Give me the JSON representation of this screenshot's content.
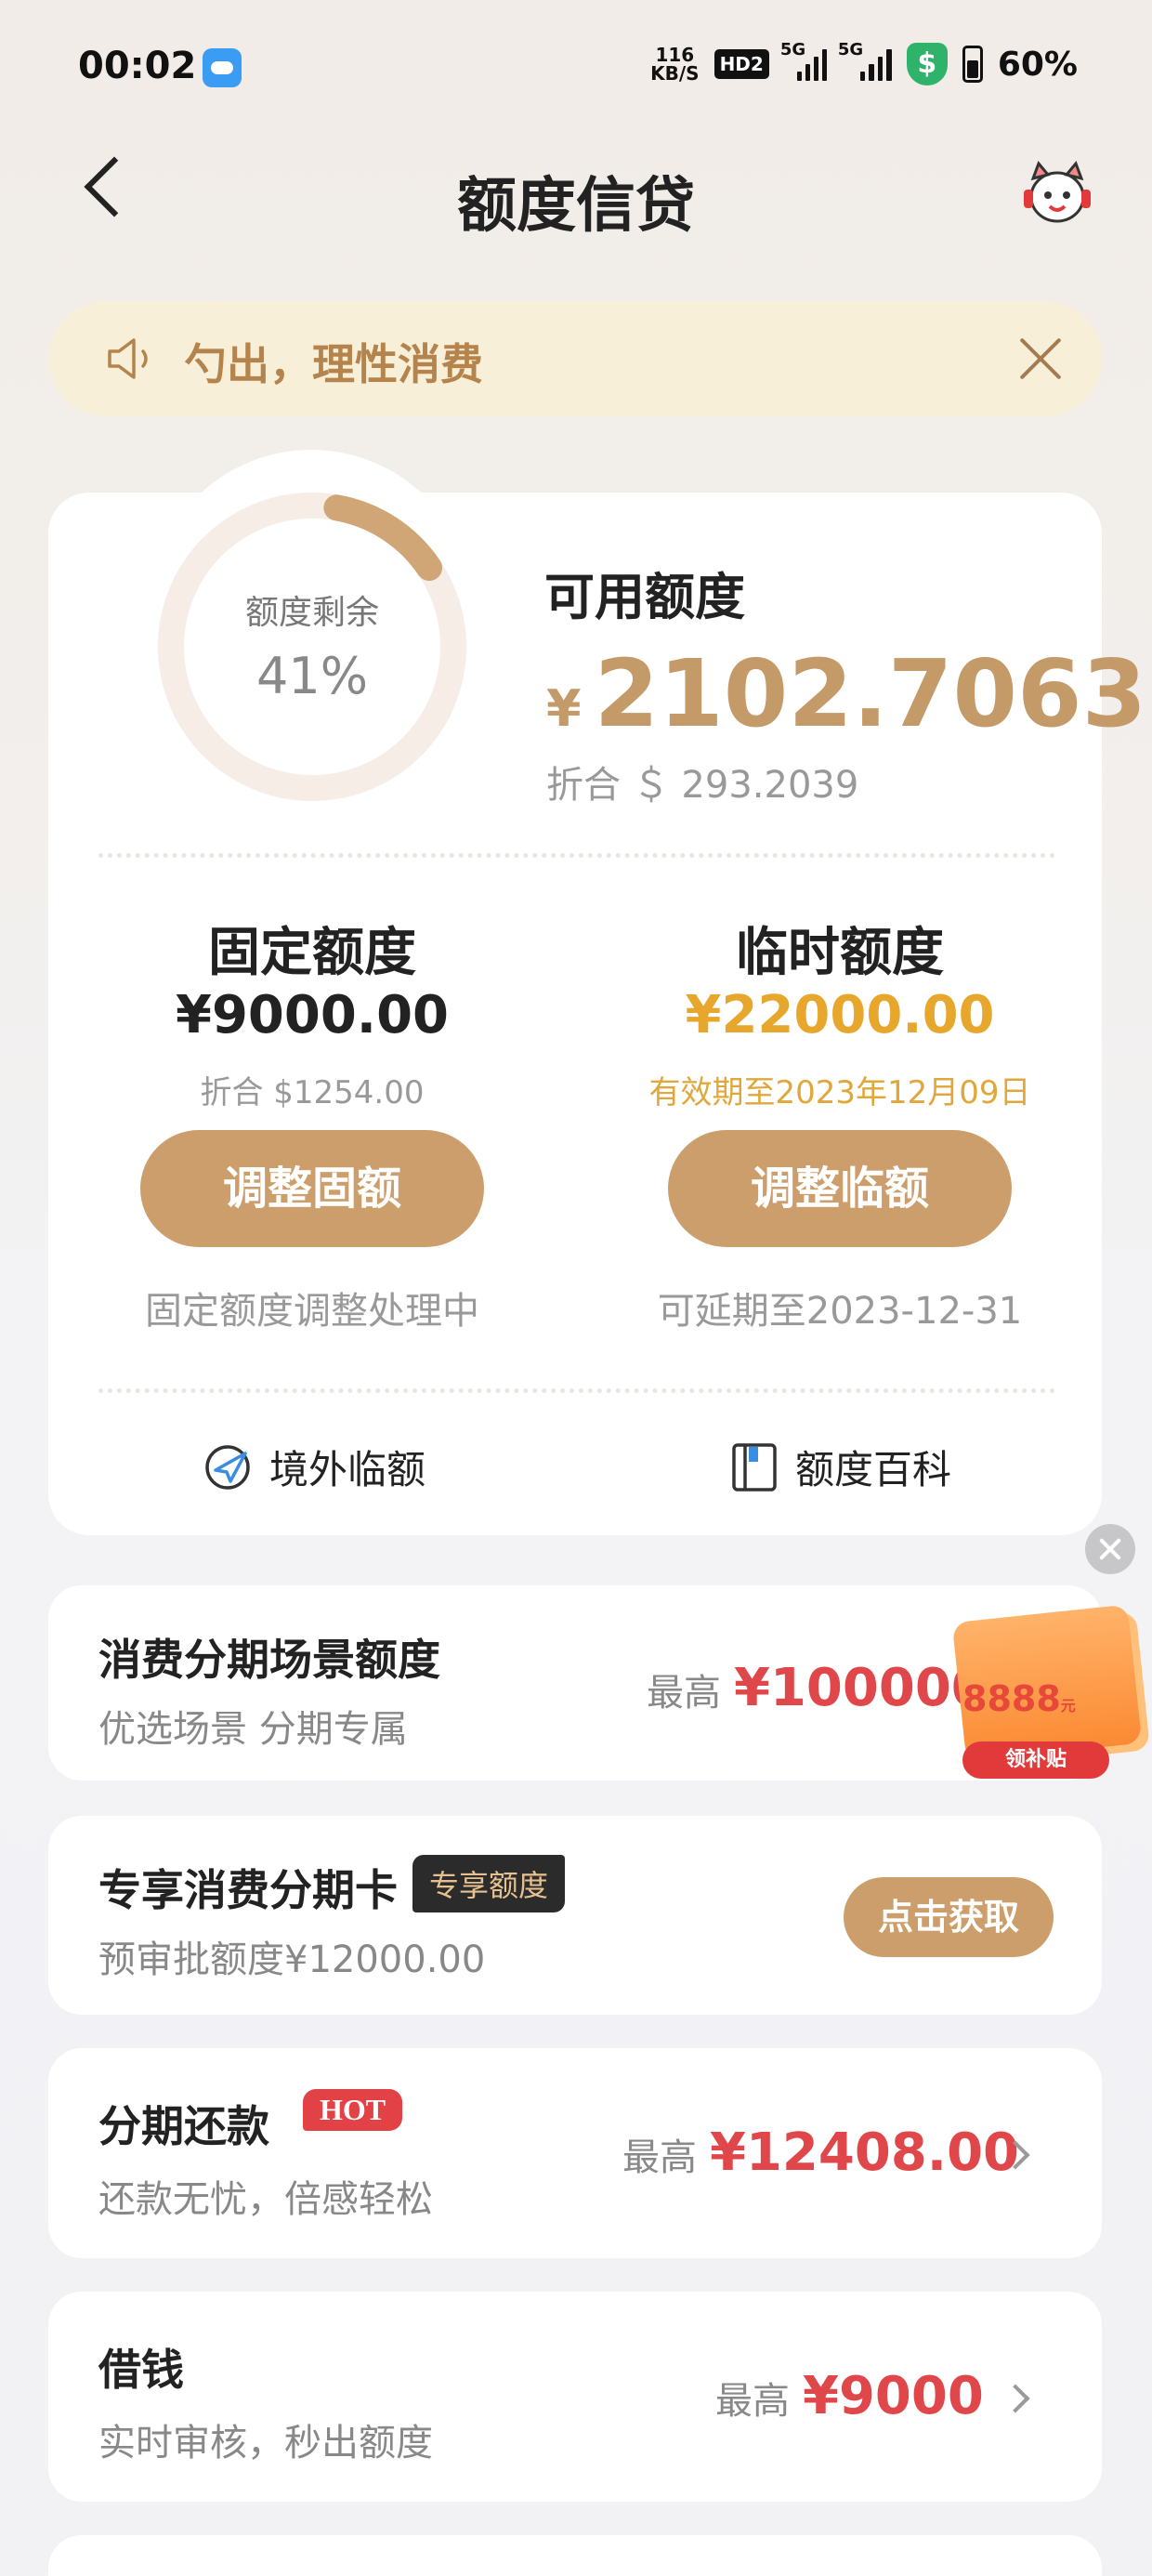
{
  "status_bar": {
    "time": "00:02",
    "net_speed_value": "116",
    "net_speed_unit": "KB/S",
    "hd_label": "HD2",
    "signal1_label": "5G",
    "signal2_label": "5G",
    "shield_symbol": "$",
    "battery": "60%"
  },
  "header": {
    "title": "额度信贷"
  },
  "notice": {
    "text": "勺出，理性消费"
  },
  "credit": {
    "ring_label": "额度剩余",
    "ring_percent_text": "41%",
    "remaining_fraction": 0.41,
    "available_title": "可用额度",
    "available_currency": "¥",
    "available_amount": "2102.7063",
    "available_converted": "折合 ＄ 293.2039"
  },
  "fixed": {
    "title": "固定额度",
    "amount": "¥9000.00",
    "converted": "折合 $1254.00",
    "button": "调整固额",
    "status": "固定额度调整处理中"
  },
  "temporary": {
    "title": "临时额度",
    "amount": "¥22000.00",
    "validity": "有效期至2023年12月09日",
    "button": "调整临额",
    "status": "可延期至2023-12-31"
  },
  "links": {
    "overseas": "境外临额",
    "encyclopedia": "额度百科"
  },
  "cards": {
    "scene": {
      "title": "消费分期场景额度",
      "subtitle": "优选场景 分期专属",
      "max_label": "最高",
      "amount": "¥100000"
    },
    "promo": {
      "amount": "8888",
      "unit": "元",
      "tag": "领补贴"
    },
    "exclusive": {
      "title": "专享消费分期卡",
      "badge": "专享额度",
      "subtitle": "预审批额度¥12000.00",
      "button": "点击获取"
    },
    "installment": {
      "title": "分期还款",
      "badge": "HOT",
      "subtitle": "还款无忧，倍感轻松",
      "max_label": "最高",
      "amount": "¥12408.00"
    },
    "borrow": {
      "title": "借钱",
      "subtitle": "实时审核，秒出额度",
      "max_label": "最高",
      "amount": "¥9000"
    }
  },
  "colors": {
    "accent_gold": "#cc9e6c",
    "temp_amount": "#e7a62c",
    "amount_red": "#e0474a"
  },
  "icons": [
    "back-icon",
    "customer-service-icon",
    "speaker-icon",
    "close-icon",
    "plane-icon",
    "book-icon",
    "chevron-right-icon"
  ]
}
